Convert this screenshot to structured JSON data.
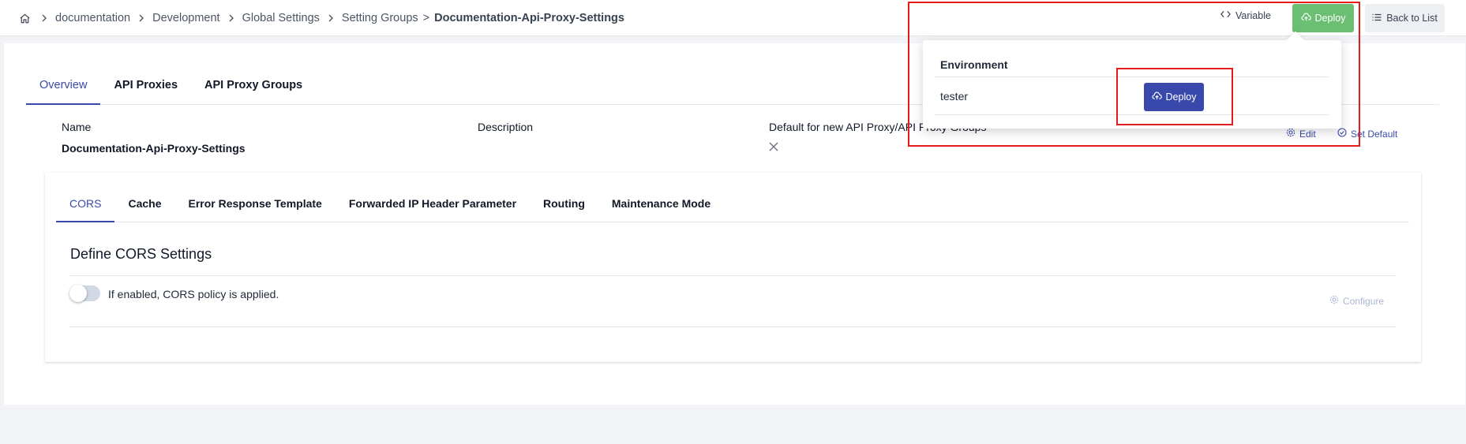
{
  "breadcrumb": {
    "items": [
      "documentation",
      "Development",
      "Global Settings",
      "Setting Groups"
    ],
    "separator_plain": ">",
    "current": "Documentation-Api-Proxy-Settings"
  },
  "header": {
    "variable_label": "Variable",
    "deploy_label": "Deploy",
    "back_label": "Back to List"
  },
  "tabs": [
    "Overview",
    "API Proxies",
    "API Proxy Groups"
  ],
  "details": {
    "name_label": "Name",
    "name_value": "Documentation-Api-Proxy-Settings",
    "description_label": "Description",
    "default_label": "Default for new API Proxy/API Proxy Groups",
    "edit_label": "Edit",
    "set_default_label": "Set Default"
  },
  "settings_tabs": [
    "CORS",
    "Cache",
    "Error Response Template",
    "Forwarded IP Header Parameter",
    "Routing",
    "Maintenance Mode"
  ],
  "cors": {
    "title": "Define CORS Settings",
    "toggle_label": "If enabled, CORS policy is applied.",
    "configure_label": "Configure"
  },
  "deploy_popover": {
    "column_header": "Environment",
    "environment": "tester",
    "deploy_label": "Deploy"
  },
  "colors": {
    "accent": "#3949ab",
    "deploy_green": "#6bbf72",
    "highlight_red": "#e31b1b"
  }
}
